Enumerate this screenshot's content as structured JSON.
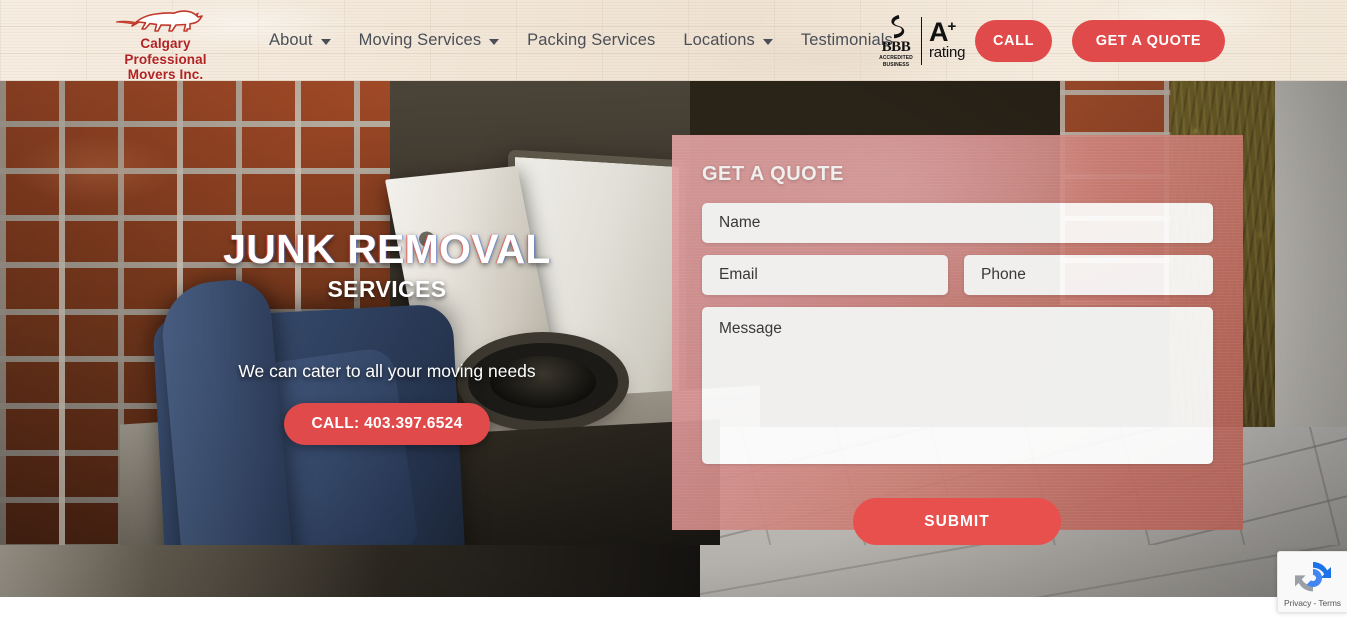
{
  "brand": {
    "logo_icon": "running-horse-icon",
    "name_line1": "Calgary Professional",
    "name_line2": "Movers Inc.",
    "accent_red": "#e04a4a",
    "logo_red": "#b22222"
  },
  "nav": {
    "items": [
      {
        "label": "About",
        "has_dropdown": true,
        "icon": "chevron-down-icon"
      },
      {
        "label": "Moving Services",
        "has_dropdown": true,
        "icon": "chevron-down-icon"
      },
      {
        "label": "Packing Services",
        "has_dropdown": false,
        "icon": ""
      },
      {
        "label": "Locations",
        "has_dropdown": true,
        "icon": "chevron-down-icon"
      },
      {
        "label": "Testimonials",
        "has_dropdown": false,
        "icon": ""
      }
    ]
  },
  "badge": {
    "icon": "bbb-torch-icon",
    "bbb": "BBB",
    "accredited_line1": "ACCREDITED",
    "accredited_line2": "BUSINESS",
    "grade": "A",
    "grade_plus": "+",
    "rating_label": "rating"
  },
  "header_buttons": {
    "call": "CALL",
    "quote": "GET A QUOTE"
  },
  "hero": {
    "title": "JUNK REMOVAL",
    "subtitle": "SERVICES",
    "tagline": "We can cater to all your moving needs",
    "cta": "CALL: 403.397.6524"
  },
  "quote_form": {
    "title": "GET A QUOTE",
    "fields": {
      "name": {
        "placeholder": "Name",
        "value": ""
      },
      "email": {
        "placeholder": "Email",
        "value": ""
      },
      "phone": {
        "placeholder": "Phone",
        "value": ""
      },
      "message": {
        "placeholder": "Message",
        "value": ""
      }
    },
    "submit": "SUBMIT",
    "panel_color": "#c87c72"
  },
  "recaptcha": {
    "icon": "recaptcha-icon",
    "text": "Privacy - Terms"
  }
}
